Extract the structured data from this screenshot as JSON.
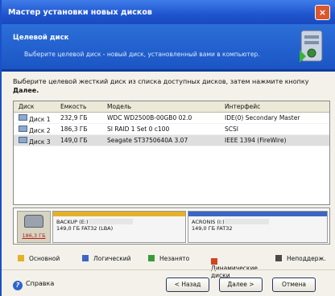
{
  "window": {
    "title": "Мастер установки новых дисков",
    "close_label": "×"
  },
  "header": {
    "title": "Целевой диск",
    "subtitle": "Выберите целевой диск - новый диск, установленный вами в компьютер."
  },
  "instruction": {
    "text": "Выберите целевой жесткий диск из списка доступных дисков, затем нажмите кнопку",
    "button_ref": "Далее."
  },
  "table": {
    "columns": [
      "Диск",
      "Емкость",
      "Модель",
      "Интерфейс"
    ],
    "rows": [
      {
        "disk": "Диск 1",
        "capacity": "232,9 ГБ",
        "model": "WDC WD2500B-00GB0 02.0",
        "interface": "IDE(0) Secondary Master"
      },
      {
        "disk": "Диск 2",
        "capacity": "186,3 ГБ",
        "model": "SI RAID 1 Set 0 c100",
        "interface": "SCSI"
      },
      {
        "disk": "Диск 3",
        "capacity": "149,0 ГБ",
        "model": "Seagate ST3750640A 3.07",
        "interface": "IEEE 1394 (FireWire)"
      }
    ],
    "selected_index": 2
  },
  "disk_map": {
    "capacity": "186,3 ГБ",
    "partitions": [
      {
        "name": "BACKUP (E:)",
        "info": "149,0 ГБ  FAT32 (LBA)",
        "color": "#e6b128"
      },
      {
        "name": "ACRONIS (I:)",
        "info": "149,0 ГБ  FAT32",
        "color": "#3b66c4"
      }
    ]
  },
  "legend": [
    {
      "label": "Основной",
      "color": "#e6b128"
    },
    {
      "label": "Логический",
      "color": "#3b66c4"
    },
    {
      "label": "Незанято",
      "color": "#3a9a3a"
    },
    {
      "label": "Динамические диски",
      "color": "#d4421e"
    },
    {
      "label": "Неподдерж.",
      "color": "#4a4a4a"
    }
  ],
  "footer": {
    "help_label": "Справка",
    "back_label": "< Назад",
    "next_label": "Далее >",
    "cancel_label": "Отмена"
  }
}
